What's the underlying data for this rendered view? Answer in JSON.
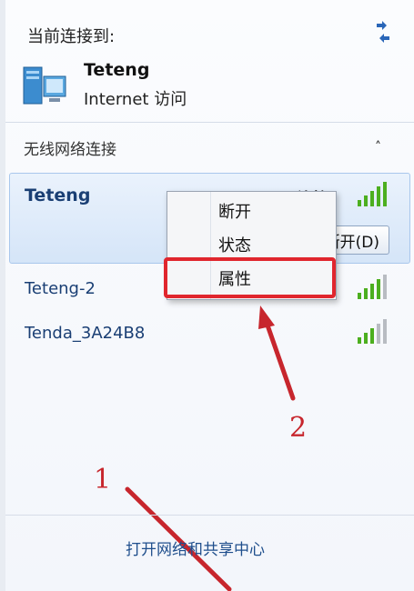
{
  "header": {
    "label": "当前连接到:"
  },
  "current": {
    "name": "Teteng",
    "access": "Internet 访问"
  },
  "section": {
    "title": "无线网络连接",
    "collapse_glyph": "˄"
  },
  "networks": [
    {
      "name": "Teteng",
      "status": "已连接",
      "button": "断开(D)"
    },
    {
      "name": "Teteng-2"
    },
    {
      "name": "Tenda_3A24B8"
    }
  ],
  "context_menu": {
    "items": [
      "断开",
      "状态",
      "属性"
    ]
  },
  "annotations": {
    "one": "1",
    "two": "2"
  },
  "footer": {
    "link": "打开网络和共享中心"
  },
  "colors": {
    "annotation": "#e0262e",
    "link": "#1f4e8c",
    "signal": "#4caf1f"
  }
}
